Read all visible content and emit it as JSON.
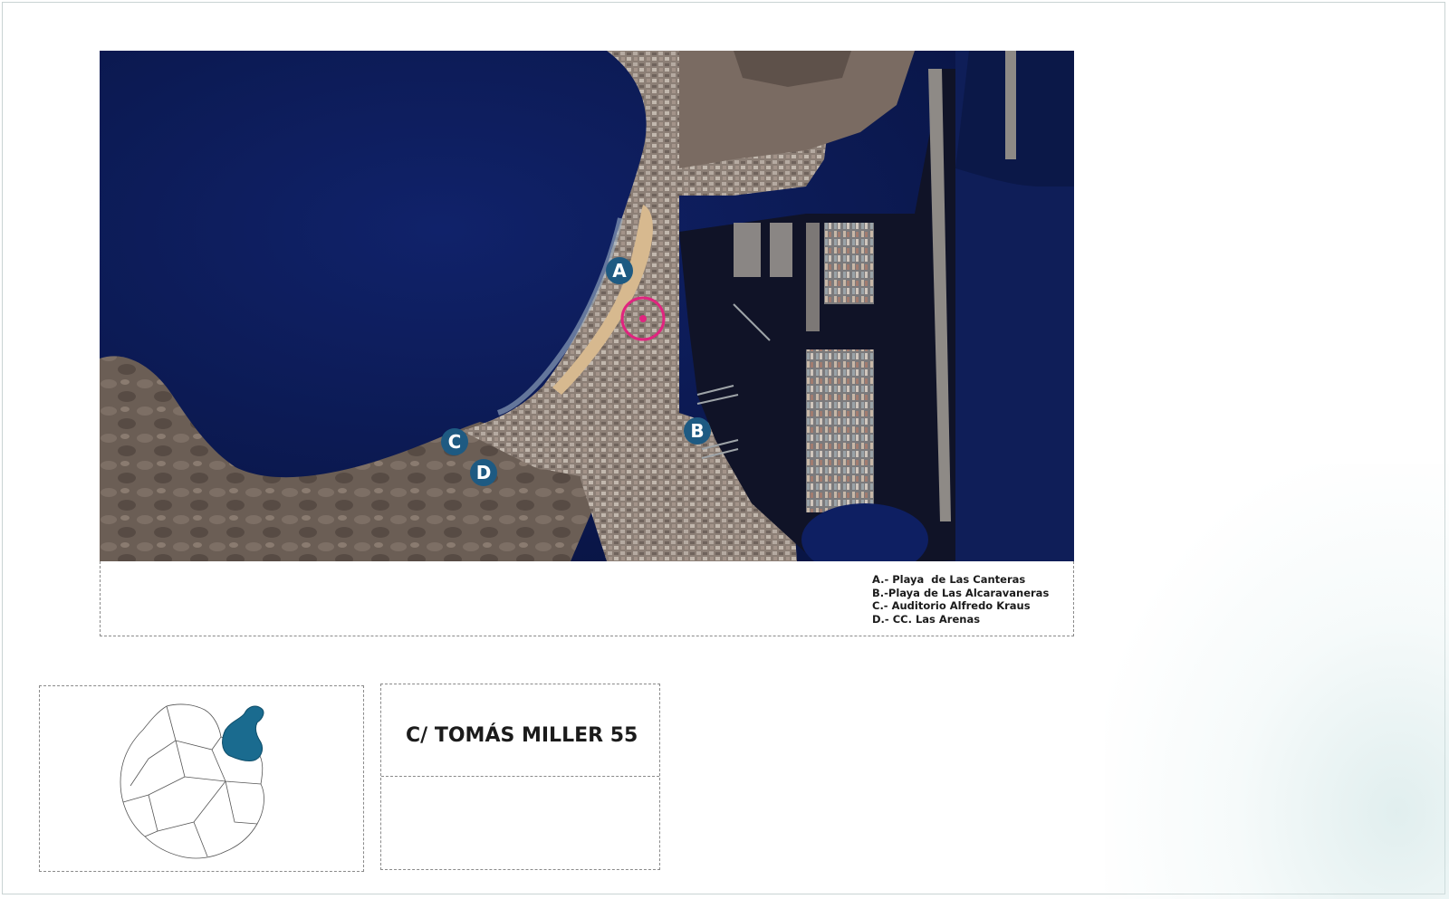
{
  "map": {
    "markers": [
      {
        "id": "A",
        "label": "A"
      },
      {
        "id": "B",
        "label": "B"
      },
      {
        "id": "C",
        "label": "C"
      },
      {
        "id": "D",
        "label": "D"
      }
    ],
    "location_marker": "pink-target-circle-icon"
  },
  "legend": {
    "items": [
      "A.- Playa  de Las Canteras",
      "B.-Playa de Las Alcaravaneras",
      "C.- Auditorio Alfredo Kraus",
      "D.- CC. Las Arenas"
    ]
  },
  "address": {
    "title": "C/ TOMÁS MILLER 55"
  },
  "colors": {
    "sea": "#0c1d55",
    "marker": "#1e5a82",
    "highlight": "#1a6b8f",
    "target": "#e0257f"
  }
}
